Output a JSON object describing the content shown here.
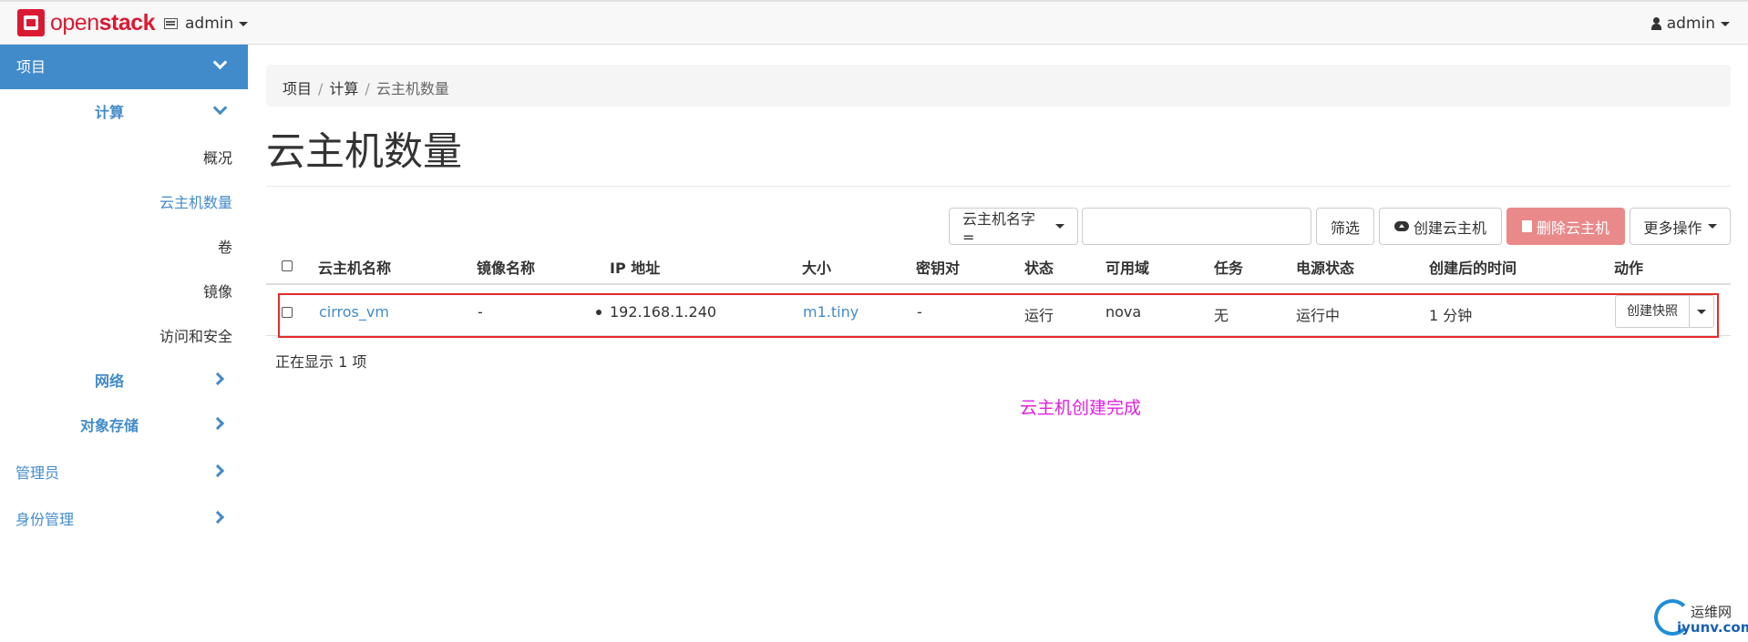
{
  "navbar": {
    "brand_open": "open",
    "brand_stack": "stack",
    "project": "admin",
    "user": "admin"
  },
  "sidebar": {
    "project": "项目",
    "compute": "计算",
    "items": [
      "概况",
      "云主机数量",
      "卷",
      "镜像",
      "访问和安全"
    ],
    "network": "网络",
    "object_storage": "对象存储",
    "admin": "管理员",
    "identity": "身份管理"
  },
  "breadcrumb": [
    "项目",
    "计算",
    "云主机数量"
  ],
  "page": {
    "title": "云主机数量"
  },
  "toolbar": {
    "filter_field": "云主机名字 =",
    "filter_value": "",
    "filter_button": "筛选",
    "create_button": "创建云主机",
    "delete_button": "删除云主机",
    "more_button": "更多操作"
  },
  "table": {
    "headers": [
      "云主机名称",
      "镜像名称",
      "IP 地址",
      "大小",
      "密钥对",
      "状态",
      "可用域",
      "任务",
      "电源状态",
      "创建后的时间",
      "动作"
    ],
    "rows": [
      {
        "name": "cirros_vm",
        "image": "-",
        "ip": "192.168.1.240",
        "size": "m1.tiny",
        "keypair": "-",
        "status": "运行",
        "zone": "nova",
        "task": "无",
        "power": "运行中",
        "age": "1 分钟",
        "action": "创建快照"
      }
    ],
    "count_text": "正在显示 1 项"
  },
  "annotation": "云主机创建完成",
  "watermark": {
    "top": "运维网",
    "bottom": "iyunv.com"
  },
  "colors": {
    "primary": "#428bca",
    "danger": "#e9898a",
    "highlight": "#e52b2b",
    "annotation": "#e020e0"
  }
}
